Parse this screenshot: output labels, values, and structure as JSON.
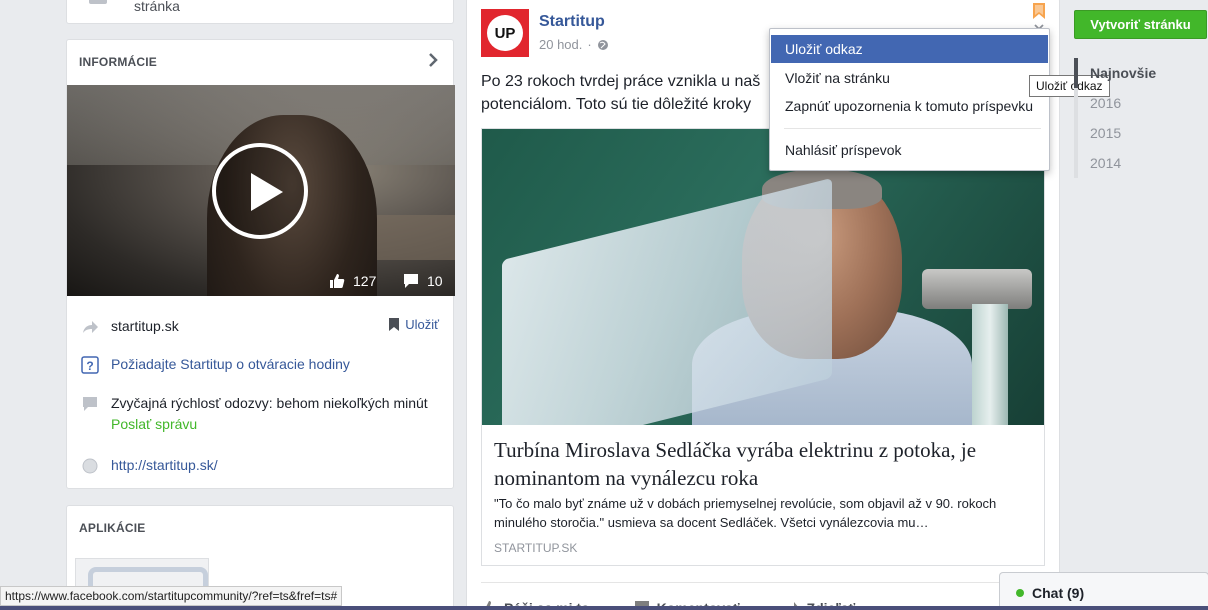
{
  "left": {
    "top_stub_text": "stránka",
    "info": {
      "heading": "INFORMÁCIE",
      "video": {
        "likes": "127",
        "comments": "10"
      },
      "website_short": "startitup.sk",
      "save_label": "Uložiť",
      "hours_request": "Požiadajte Startitup o otváracie hodiny",
      "response_speed": "Zvyčajná rýchlosť odozvy: behom niekoľkých minút",
      "send_message": "Poslať správu",
      "website_url": "http://startitup.sk/"
    },
    "apps_heading": "APLIKÁCIE"
  },
  "post": {
    "page_name": "Startitup",
    "avatar_text": "UP",
    "time": "20 hod.",
    "text_line1": "Po 23 rokoch tvrdej práce vznikla u naš",
    "text_line2": "potenciálom. Toto sú tie dôležité kroky",
    "link": {
      "title": "Turbína Miroslava Sedláčka vyrába elektrinu z potoka, je nominantom na vynálezcu roka",
      "description": "\"To čo malo byť známe už v dobách priemyselnej revolúcie, som objavil až v 90. rokoch minulého storočia.\" usmieva sa docent Sedláček. Všetci vynálezcovia mu…",
      "source": "STARTITUP.SK"
    },
    "actions": {
      "like": "Páči sa mi to",
      "comment": "Komentovať",
      "share": "Zdieľať"
    }
  },
  "dropdown": {
    "items": [
      "Uložiť odkaz",
      "Vložiť na stránku",
      "Zapnúť upozornenia k tomuto príspevku",
      "Nahlásiť príspevok"
    ],
    "tooltip": "Uložiť odkaz"
  },
  "right": {
    "create_page": "Vytvoriť stránku",
    "timeline": [
      "Najnovšie",
      "2016",
      "2015",
      "2014"
    ]
  },
  "status_url": "https://www.facebook.com/startitupcommunity/?ref=ts&fref=ts#",
  "chat": {
    "label": "Chat (9)"
  },
  "colors": {
    "accent": "#4267b2",
    "link": "#365899",
    "green": "#42b72a",
    "brand_red": "#e1262e"
  }
}
